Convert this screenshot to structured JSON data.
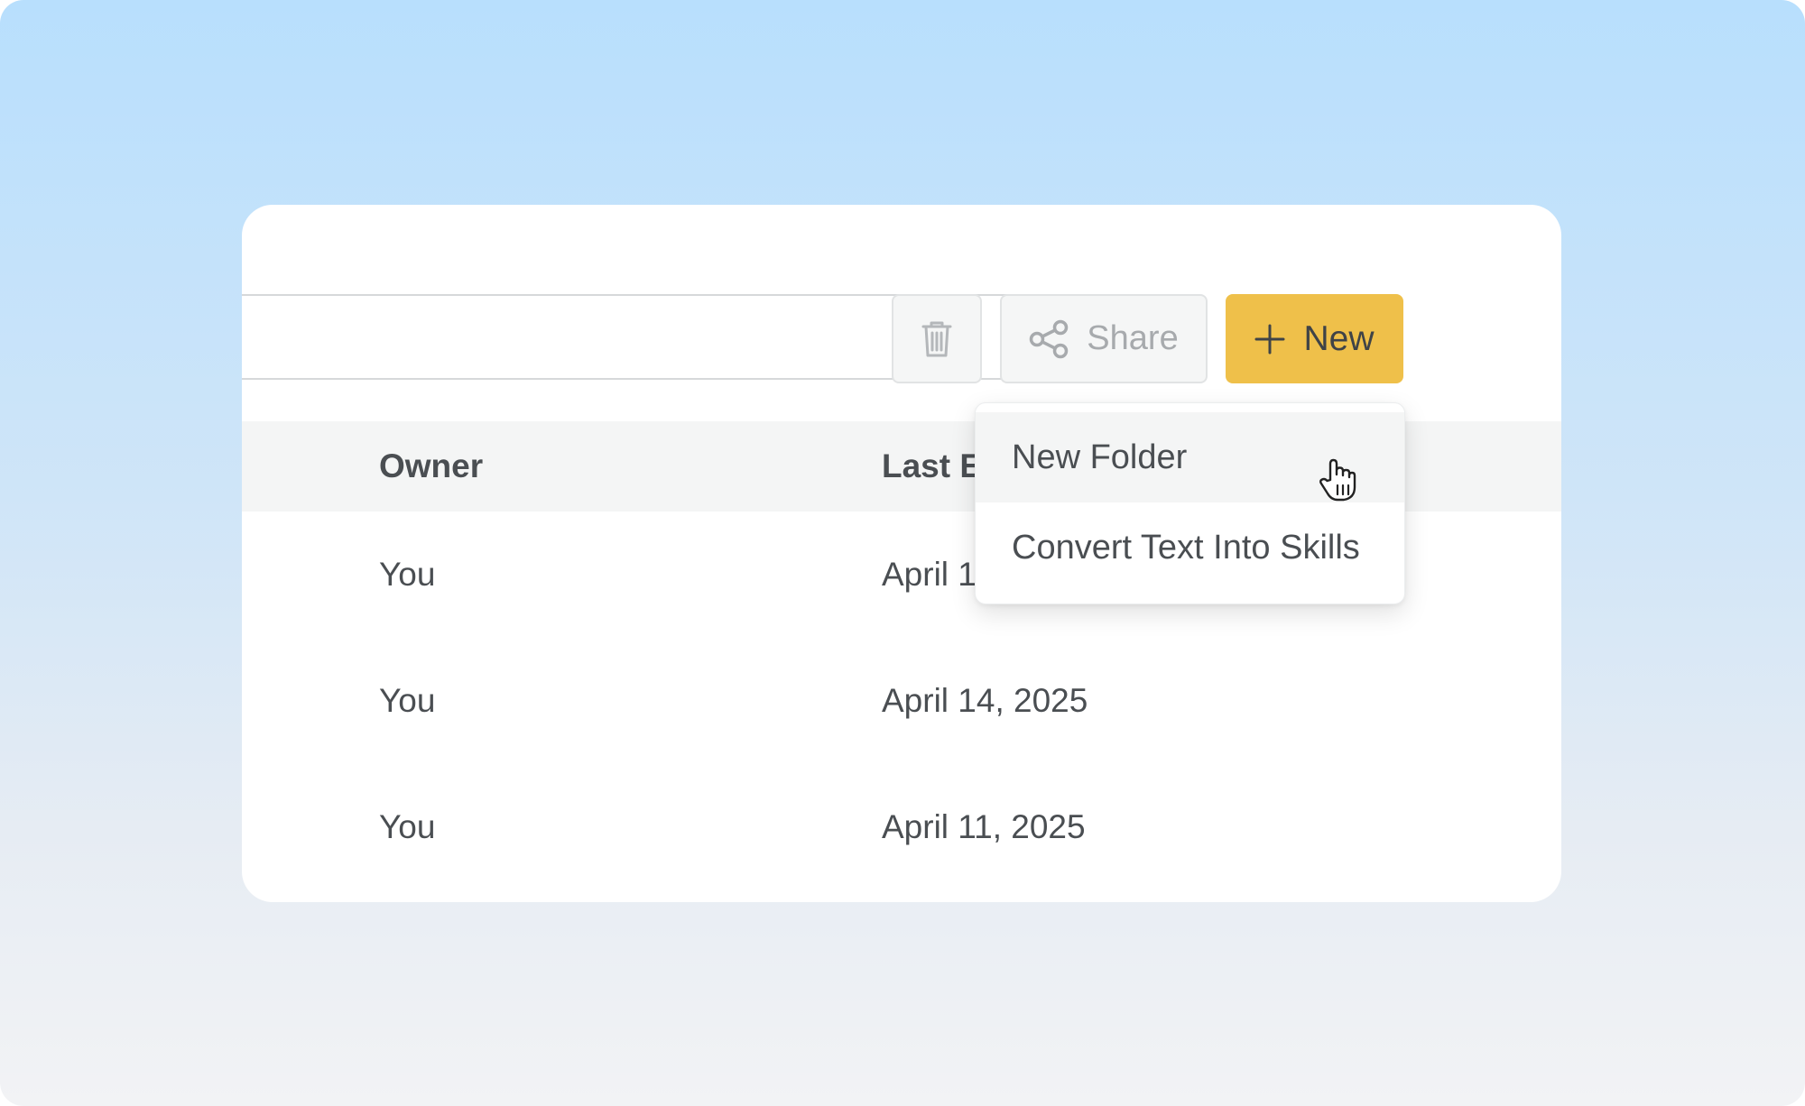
{
  "toolbar": {
    "search_value": "",
    "share_label": "Share",
    "new_label": "New"
  },
  "table": {
    "columns": [
      "Owner",
      "Last E"
    ],
    "rows": [
      {
        "owner": "You",
        "last_edited": "April 1"
      },
      {
        "owner": "You",
        "last_edited": "April 14, 2025"
      },
      {
        "owner": "You",
        "last_edited": "April 11, 2025"
      }
    ]
  },
  "new_menu": {
    "items": [
      {
        "label": "New Folder",
        "hovered": true
      },
      {
        "label": "Convert Text Into Skills",
        "hovered": false
      }
    ]
  },
  "icons": {
    "trash": "trash-icon",
    "share": "share-icon",
    "plus": "plus-icon",
    "cursor": "hand-pointer-cursor-icon"
  },
  "colors": {
    "primary_button": "#efc04a",
    "text": "#4a4e52",
    "muted_text": "#a7aaad",
    "header_bg": "#f4f5f5"
  }
}
